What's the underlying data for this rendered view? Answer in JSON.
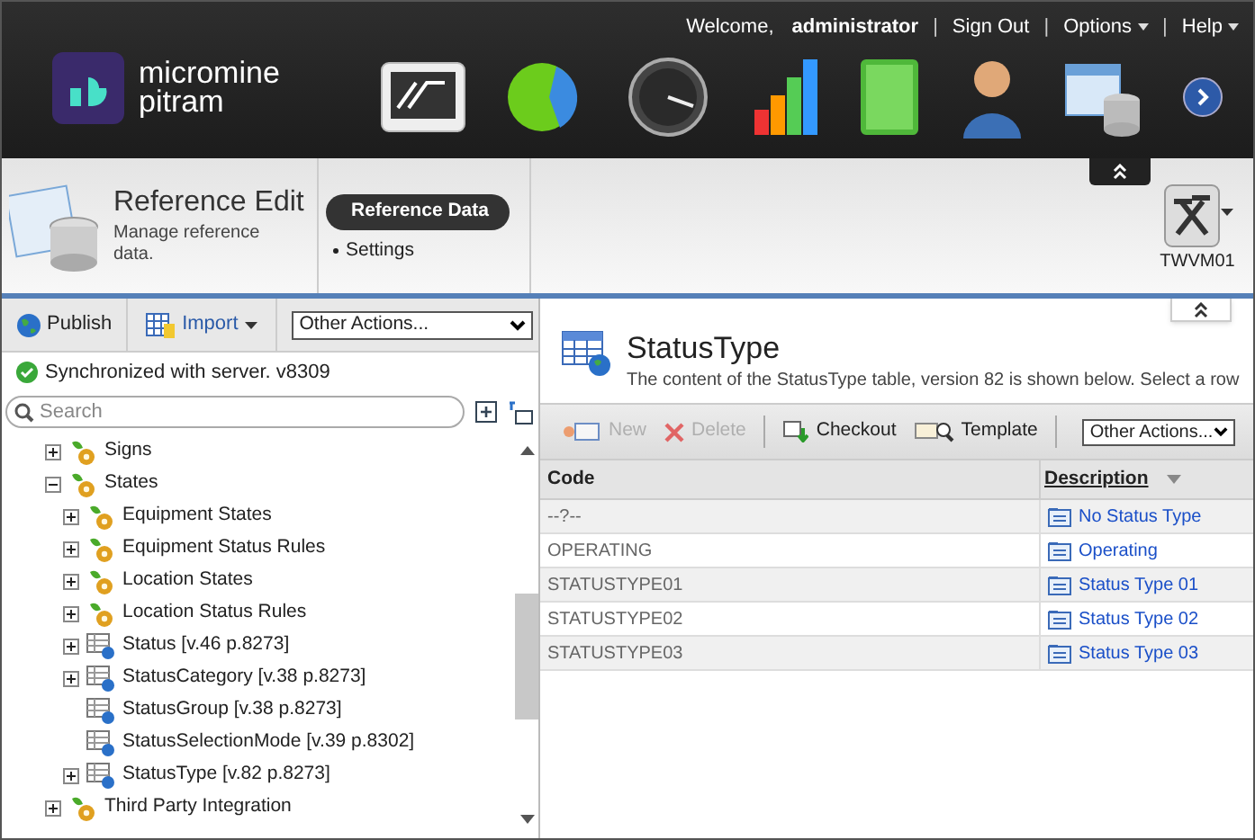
{
  "top_links": {
    "welcome": "Welcome,",
    "user": "administrator",
    "separator": "|",
    "links": [
      {
        "label": "Sign Out",
        "dropdown": false
      },
      {
        "label": "Options",
        "dropdown": true
      },
      {
        "label": "Help",
        "dropdown": true
      }
    ]
  },
  "logo": {
    "line1": "micromine",
    "line2": "pitram"
  },
  "module": {
    "title": "Reference Edit",
    "subtitle": "Manage reference data."
  },
  "nav": [
    {
      "label": "Reference Data",
      "selected": true
    },
    {
      "label": "Settings",
      "selected": false
    }
  ],
  "server": {
    "label": "TWVM01"
  },
  "left_toolbar": {
    "publish": "Publish",
    "import": "Import",
    "other_actions": "Other Actions..."
  },
  "sync_status": "Synchronized with server. v8309",
  "search": {
    "placeholder": "Search"
  },
  "tree": [
    {
      "label": "Signs",
      "kind": "group",
      "expanded": false
    },
    {
      "label": "States",
      "kind": "group",
      "expanded": true,
      "children": [
        {
          "label": "Equipment States",
          "kind": "group",
          "expanded": false
        },
        {
          "label": "Equipment Status Rules",
          "kind": "group",
          "expanded": false
        },
        {
          "label": "Location States",
          "kind": "group",
          "expanded": false
        },
        {
          "label": "Location Status Rules",
          "kind": "group",
          "expanded": false
        },
        {
          "label": "Status [v.46 p.8273]",
          "kind": "table",
          "expanded": false
        },
        {
          "label": "StatusCategory [v.38 p.8273]",
          "kind": "table",
          "expanded": false
        },
        {
          "label": "StatusGroup [v.38 p.8273]",
          "kind": "table"
        },
        {
          "label": "StatusSelectionMode [v.39 p.8302]",
          "kind": "table"
        },
        {
          "label": "StatusType [v.82 p.8273]",
          "kind": "table",
          "expanded": false
        }
      ]
    },
    {
      "label": "Third Party Integration",
      "kind": "group",
      "expanded": false
    }
  ],
  "content": {
    "title": "StatusType",
    "description": "The content of the StatusType table, version 82 is shown below. Select a row"
  },
  "toolbar": [
    {
      "label": "New",
      "kind": "new",
      "disabled": true
    },
    {
      "label": "Delete",
      "kind": "delete",
      "disabled": true
    },
    {
      "label": "Checkout",
      "kind": "checkout",
      "disabled": false
    },
    {
      "label": "Template",
      "kind": "template",
      "disabled": false
    }
  ],
  "other_actions": "Other Actions...",
  "table": {
    "columns": [
      "Code",
      "Description"
    ],
    "rows": [
      {
        "code": "--?--",
        "description": "No Status Type"
      },
      {
        "code": "OPERATING",
        "description": "Operating"
      },
      {
        "code": "STATUSTYPE01",
        "description": "Status Type 01"
      },
      {
        "code": "STATUSTYPE02",
        "description": "Status Type 02"
      },
      {
        "code": "STATUSTYPE03",
        "description": "Status Type 03"
      }
    ]
  }
}
